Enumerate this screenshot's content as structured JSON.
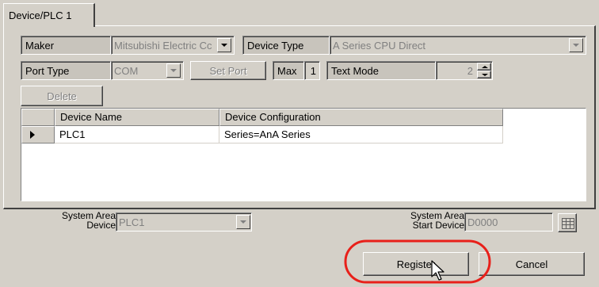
{
  "tab": {
    "label": "Device/PLC 1"
  },
  "maker": {
    "label": "Maker",
    "value": "Mitsubishi Electric Cc"
  },
  "device_type": {
    "label": "Device Type",
    "value": "A Series CPU Direct"
  },
  "port_type": {
    "label": "Port Type",
    "value": "COM"
  },
  "set_port": {
    "label": "Set Port"
  },
  "max": {
    "label": "Max",
    "value": "1"
  },
  "text_mode": {
    "label": "Text Mode",
    "value": "2"
  },
  "delete": {
    "label": "Delete"
  },
  "table": {
    "columns": [
      "Device Name",
      "Device Configuration"
    ],
    "rows": [
      {
        "name": "PLC1",
        "config": "Series=AnA Series"
      }
    ]
  },
  "system_area_device": {
    "label_line1": "System Area",
    "label_line2": "Device",
    "value": "PLC1"
  },
  "system_area_start": {
    "label_line1": "System Area",
    "label_line2": "Start Device",
    "value": "D0000"
  },
  "buttons": {
    "register": "Register",
    "cancel": "Cancel"
  },
  "colors": {
    "highlight_circle": "#e8201a"
  }
}
